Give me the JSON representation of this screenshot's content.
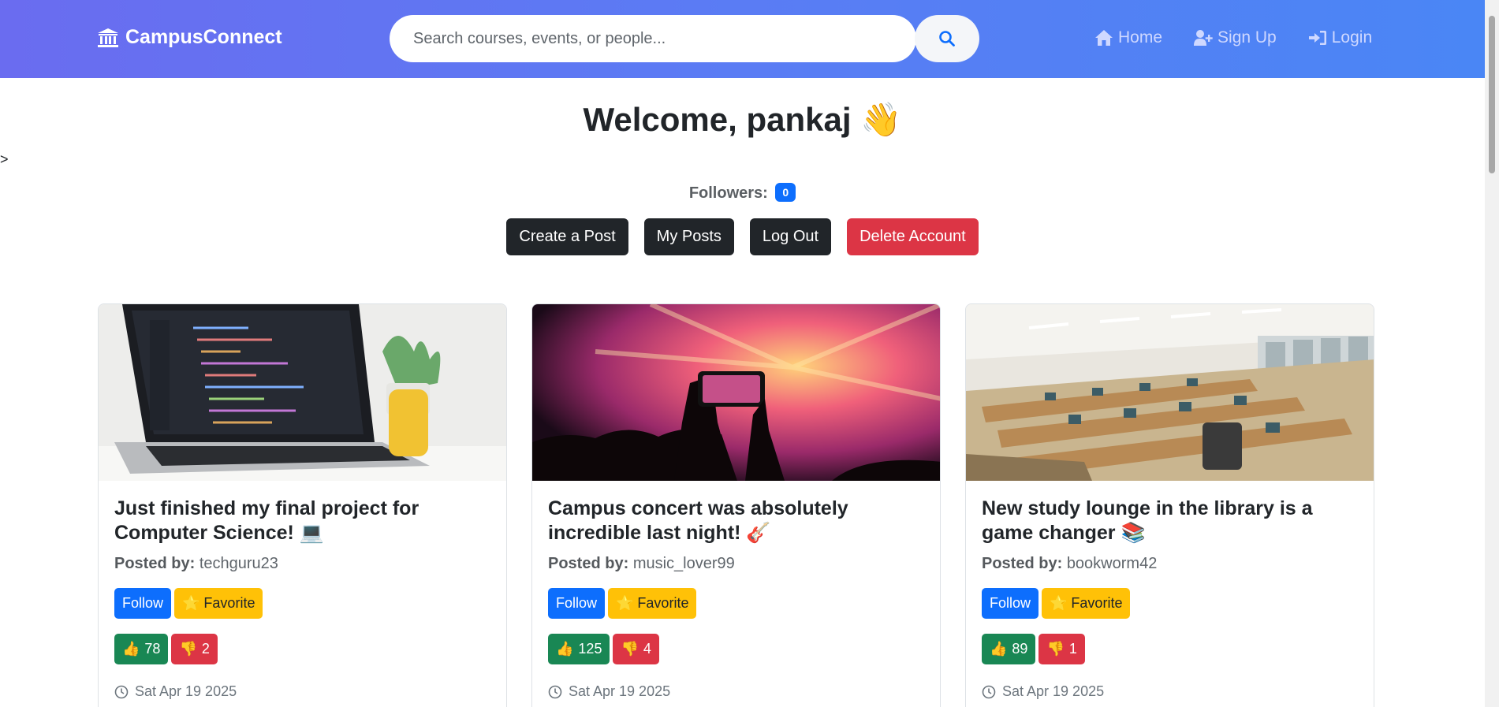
{
  "navbar": {
    "brand": "CampusConnect",
    "search": {
      "placeholder": "Search courses, events, or people...",
      "value": ""
    },
    "links": [
      {
        "label": "Home",
        "icon": "home-icon"
      },
      {
        "label": "Sign Up",
        "icon": "user-plus-icon"
      },
      {
        "label": "Login",
        "icon": "login-icon"
      }
    ]
  },
  "stray_text": ">",
  "welcome": {
    "title": "Welcome, pankaj 👋"
  },
  "followers": {
    "label": "Followers:",
    "count": "0"
  },
  "actions": {
    "create": "Create a Post",
    "my_posts": "My Posts",
    "logout": "Log Out",
    "delete": "Delete Account"
  },
  "posts": [
    {
      "title": "Just finished my final project for Computer Science! 💻",
      "posted_by_label": "Posted by:",
      "author": "techguru23",
      "follow": "Follow",
      "favorite": "⭐ Favorite",
      "likes": "78",
      "dislikes": "2",
      "date": "Sat Apr 19 2025"
    },
    {
      "title": "Campus concert was absolutely incredible last night! 🎸",
      "posted_by_label": "Posted by:",
      "author": "music_lover99",
      "follow": "Follow",
      "favorite": "⭐ Favorite",
      "likes": "125",
      "dislikes": "4",
      "date": "Sat Apr 19 2025"
    },
    {
      "title": "New study lounge in the library is a game changer 📚",
      "posted_by_label": "Posted by:",
      "author": "bookworm42",
      "follow": "Follow",
      "favorite": "⭐ Favorite",
      "likes": "89",
      "dislikes": "1",
      "date": "Sat Apr 19 2025"
    }
  ],
  "colors": {
    "nav_start": "#6a6cf0",
    "nav_end": "#4a86f5",
    "primary": "#0d6efd",
    "danger": "#dc3545",
    "success": "#198754",
    "warning": "#ffc107"
  }
}
